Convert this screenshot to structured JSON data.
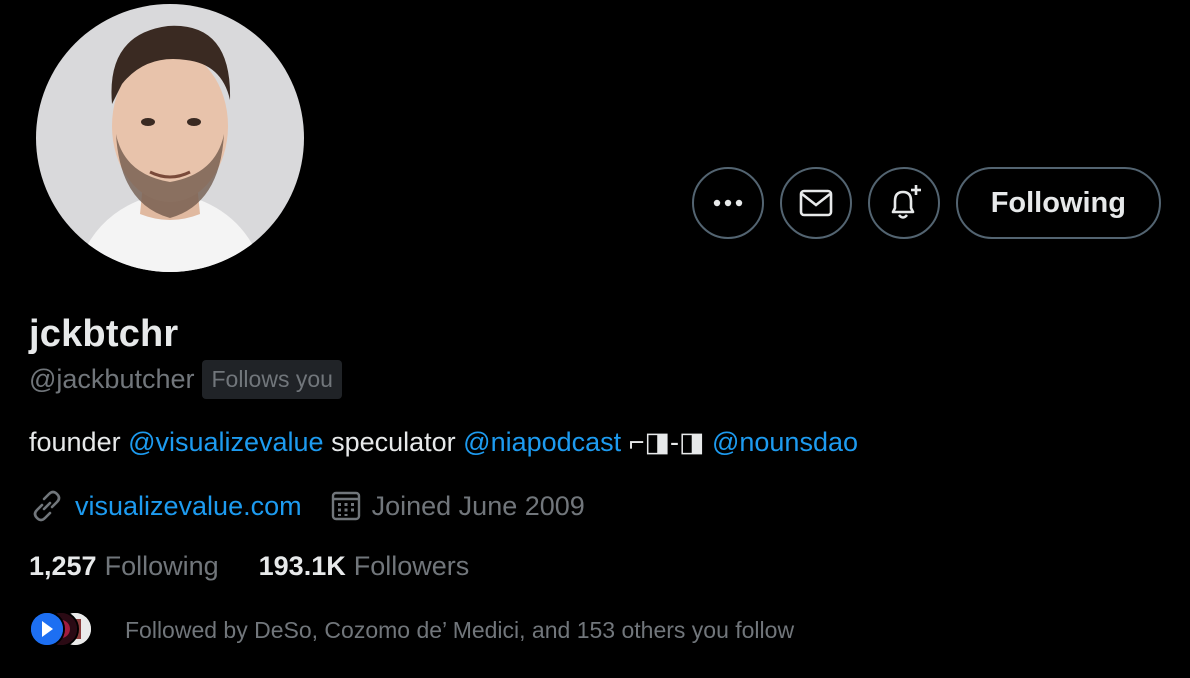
{
  "profile": {
    "display_name": "jckbtchr",
    "handle": "@jackbutcher",
    "follows_you_badge": "Follows you",
    "avatar_icon": "profile-photo"
  },
  "actions": {
    "more_icon": "more-icon",
    "message_icon": "mail-icon",
    "notify_icon": "bell-plus-icon",
    "following_label": "Following"
  },
  "bio": {
    "segments": [
      {
        "text": "founder ",
        "type": "text"
      },
      {
        "text": "@visualizevalue",
        "type": "mention"
      },
      {
        "text": " speculator ",
        "type": "text"
      },
      {
        "text": "@niapodcast",
        "type": "mention"
      },
      {
        "text": " ⌐◨-◨ ",
        "type": "text"
      },
      {
        "text": "@nounsdao",
        "type": "mention"
      }
    ]
  },
  "meta": {
    "link_icon": "link-icon",
    "website": "visualizevalue.com",
    "calendar_icon": "calendar-icon",
    "joined": "Joined June 2009"
  },
  "stats": {
    "following_count": "1,257",
    "following_label": "Following",
    "followers_count": "193.1K",
    "followers_label": "Followers"
  },
  "followed_by": {
    "text": "Followed by DeSo, Cozomo de’ Medici, and 153 others you follow"
  },
  "colors": {
    "background": "#000000",
    "primary_text": "#e7e9ea",
    "secondary_text": "#71767b",
    "accent": "#1d9bf0",
    "border": "#536471"
  }
}
